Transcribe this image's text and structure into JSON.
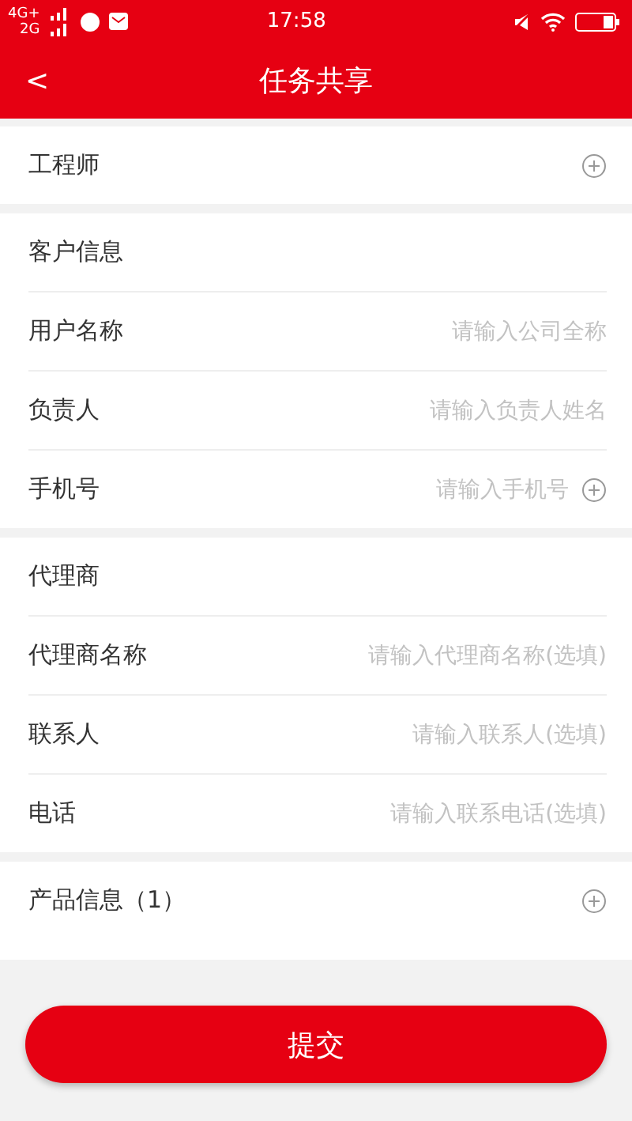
{
  "status_bar": {
    "network_1": "4G+",
    "network_2": "2G",
    "time": "17:58"
  },
  "header": {
    "back": "<",
    "title": "任务共享"
  },
  "sections": [
    {
      "rows": [
        {
          "kind": "header",
          "label": "工程师",
          "add": true
        }
      ]
    },
    {
      "rows": [
        {
          "kind": "header",
          "label": "客户信息",
          "add": false
        },
        {
          "kind": "field",
          "label": "用户名称",
          "placeholder": "请输入公司全称",
          "add": false
        },
        {
          "kind": "field",
          "label": "负责人",
          "placeholder": "请输入负责人姓名",
          "add": false
        },
        {
          "kind": "field",
          "label": "手机号",
          "placeholder": "请输入手机号",
          "add": true
        }
      ]
    },
    {
      "rows": [
        {
          "kind": "header",
          "label": "代理商",
          "add": false
        },
        {
          "kind": "field",
          "label": "代理商名称",
          "placeholder": "请输入代理商名称(选填)",
          "add": false
        },
        {
          "kind": "field",
          "label": "联系人",
          "placeholder": "请输入联系人(选填)",
          "add": false
        },
        {
          "kind": "field",
          "label": "电话",
          "placeholder": "请输入联系电话(选填)",
          "add": false
        }
      ]
    },
    {
      "rows": [
        {
          "kind": "header",
          "label": "产品信息（1）",
          "add": true
        }
      ]
    }
  ],
  "submit": "提交"
}
